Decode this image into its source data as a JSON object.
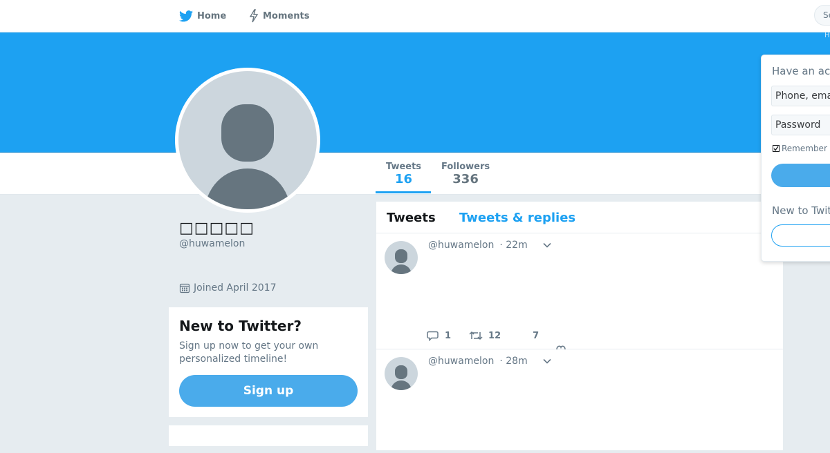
{
  "nav": {
    "home_label": "Home",
    "moments_label": "Moments",
    "search_placeholder": "Se",
    "logo_icon": "twitter-bird-icon",
    "moments_icon": "lightning-icon"
  },
  "banner": {
    "color": "#1da1f2",
    "edge_text": "H"
  },
  "profile": {
    "display_name": "□□□□□",
    "handle": "@huwamelon",
    "joined": "Joined April 2017",
    "stats": {
      "tweets_label": "Tweets",
      "tweets_value": "16",
      "followers_label": "Followers",
      "followers_value": "336"
    }
  },
  "signup_card": {
    "title": "New to Twitter?",
    "text": "Sign up now to get your own personalized timeline!",
    "button_label": "Sign up"
  },
  "timeline": {
    "tabs": [
      "Tweets",
      "Tweets & replies"
    ],
    "tweets": [
      {
        "handle": "@huwamelon",
        "time": "· 22m",
        "replies": "1",
        "retweets": "12",
        "likes": "7"
      },
      {
        "handle": "@huwamelon",
        "time": "· 28m"
      }
    ]
  },
  "login_panel": {
    "title": "Have an acc",
    "phone_placeholder": "Phone, ema",
    "password_placeholder": "Password",
    "remember_label": "Remember r",
    "new_label": "New to Twitt"
  },
  "colors": {
    "accent": "#1da1f2",
    "button": "#4aabeb",
    "background": "#e6ecf0"
  }
}
